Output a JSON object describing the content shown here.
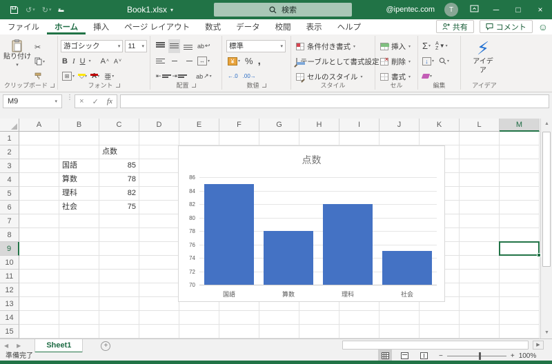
{
  "titlebar": {
    "title": "Book1.xlsx",
    "search_placeholder": "検索",
    "account": "@ipentec.com",
    "avatar_initial": "T"
  },
  "tabs": {
    "items": [
      {
        "label": "ファイル",
        "active": false
      },
      {
        "label": "ホーム",
        "active": true
      },
      {
        "label": "挿入",
        "active": false
      },
      {
        "label": "ページ レイアウト",
        "active": false
      },
      {
        "label": "数式",
        "active": false
      },
      {
        "label": "データ",
        "active": false
      },
      {
        "label": "校閲",
        "active": false
      },
      {
        "label": "表示",
        "active": false
      },
      {
        "label": "ヘルプ",
        "active": false
      }
    ],
    "share_label": "共有",
    "comments_label": "コメント"
  },
  "ribbon": {
    "clipboard": {
      "group_label": "クリップボード",
      "paste_label": "貼り付け"
    },
    "font": {
      "group_label": "フォント",
      "font_name": "游ゴシック",
      "font_size": "11",
      "bold": "B",
      "italic": "I",
      "underline": "U",
      "grow": "A",
      "shrink": "A",
      "ruby": "亜"
    },
    "alignment": {
      "group_label": "配置",
      "wrap": "ab",
      "orient": "ab"
    },
    "number": {
      "group_label": "数値",
      "format": "標準",
      "currency": "¥",
      "percent": "%",
      "comma": ",",
      "inc_dec": "←.0",
      "dec_dec": ".00→"
    },
    "styles": {
      "group_label": "スタイル",
      "conditional": "条件付き書式",
      "format_table": "テーブルとして書式設定",
      "cell_styles": "セルのスタイル"
    },
    "cells": {
      "group_label": "セル",
      "insert": "挿入",
      "delete": "削除",
      "format": "書式"
    },
    "editing": {
      "group_label": "編集",
      "autosum": "Σ",
      "sort": "AZ"
    },
    "ideas": {
      "group_label": "アイデア",
      "button_label": "アイデア"
    }
  },
  "formula_bar": {
    "name_box": "M9",
    "formula": ""
  },
  "grid": {
    "columns": [
      "A",
      "B",
      "C",
      "D",
      "E",
      "F",
      "G",
      "H",
      "I",
      "J",
      "K",
      "L",
      "M"
    ],
    "row_count": 15,
    "selected_column": "M",
    "selected_row": 9,
    "selection_ref": "M9",
    "cells": [
      {
        "col": "C",
        "row": 2,
        "text": "点数",
        "align": "left"
      },
      {
        "col": "B",
        "row": 3,
        "text": "国語",
        "align": "left"
      },
      {
        "col": "C",
        "row": 3,
        "text": "85",
        "align": "right"
      },
      {
        "col": "B",
        "row": 4,
        "text": "算数",
        "align": "left"
      },
      {
        "col": "C",
        "row": 4,
        "text": "78",
        "align": "right"
      },
      {
        "col": "B",
        "row": 5,
        "text": "理科",
        "align": "left"
      },
      {
        "col": "C",
        "row": 5,
        "text": "82",
        "align": "right"
      },
      {
        "col": "B",
        "row": 6,
        "text": "社会",
        "align": "left"
      },
      {
        "col": "C",
        "row": 6,
        "text": "75",
        "align": "right"
      }
    ]
  },
  "chart_data": {
    "type": "bar",
    "title": "点数",
    "categories": [
      "国語",
      "算数",
      "理科",
      "社会"
    ],
    "values": [
      85,
      78,
      82,
      75
    ],
    "ylim": [
      70,
      86
    ],
    "ytick_step": 2,
    "grid": true,
    "legend": "none",
    "bar_color": "#4472C4"
  },
  "sheet_tabs": {
    "active": "Sheet1",
    "add": "+"
  },
  "status_bar": {
    "ready": "準備完了",
    "zoom": "100%",
    "zoom_minus": "−",
    "zoom_plus": "+"
  },
  "colors": {
    "accent": "#217346",
    "bar": "#4472C4",
    "fill_yellow": "#ffe600",
    "font_red": "#c00000"
  }
}
